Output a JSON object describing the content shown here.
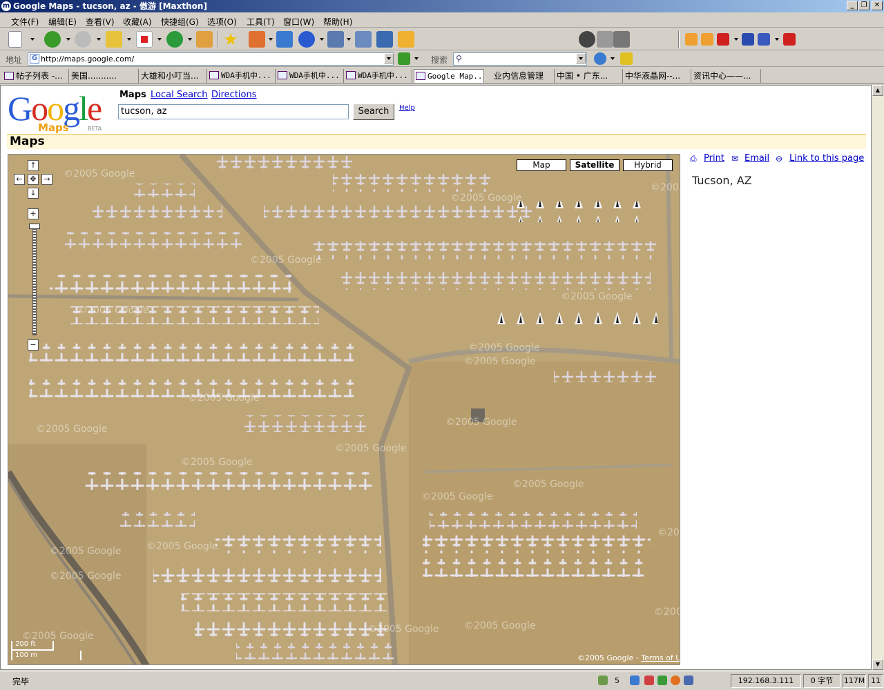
{
  "window": {
    "title": "Google Maps - tucson, az - 傲游 [Maxthon]",
    "app_icon": "m"
  },
  "menu": [
    "文件(F)",
    "编辑(E)",
    "查看(V)",
    "收藏(A)",
    "快捷组(G)",
    "选项(O)",
    "工具(T)",
    "窗口(W)",
    "帮助(H)"
  ],
  "address": {
    "label": "地址",
    "url": "http://maps.google.com/",
    "search_label": "搜索"
  },
  "tabs": [
    "帖子列表 -...",
    "美国...........",
    "大雄和小叮当...",
    "WDA手机中...",
    "WDA手机中...",
    "WDA手机中...",
    "Google Map...",
    "业内信息管理",
    "中国 • 广东...",
    "中华液晶网--...",
    "资讯中心——..."
  ],
  "google": {
    "logo_text": "Google",
    "logo_sub": "Maps",
    "logo_beta": "BETA",
    "nav_current": "Maps",
    "nav_local": "Local Search",
    "nav_directions": "Directions",
    "query": "tucson, az",
    "search_label": "Search",
    "help": "Help",
    "section_title": "Maps"
  },
  "map": {
    "type_buttons": [
      "Map",
      "Satellite",
      "Hybrid"
    ],
    "selected_type": "Satellite",
    "watermark": "©2005 Google",
    "scale_ft": "200 ft",
    "scale_m": "100 m",
    "copyright": "©2005 Google - ",
    "terms": "Terms of Use"
  },
  "side": {
    "print": "Print",
    "email": "Email",
    "link": "Link to this page",
    "location": "Tucson, AZ"
  },
  "status": {
    "text": "完毕",
    "count": "5",
    "ip": "192.168.3.111",
    "bytes": "0 字节",
    "memory": "117M",
    "extra": "11"
  }
}
